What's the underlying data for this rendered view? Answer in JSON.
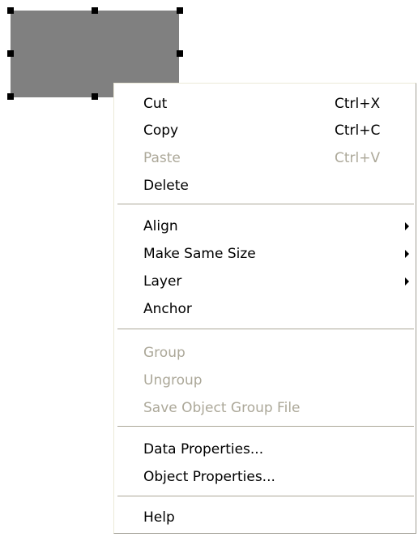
{
  "menu": {
    "cut": {
      "label": "Cut",
      "shortcut": "Ctrl+X"
    },
    "copy": {
      "label": "Copy",
      "shortcut": "Ctrl+C"
    },
    "paste": {
      "label": "Paste",
      "shortcut": "Ctrl+V"
    },
    "delete": {
      "label": "Delete"
    },
    "align": {
      "label": "Align"
    },
    "make_same_size": {
      "label": "Make Same Size"
    },
    "layer": {
      "label": "Layer"
    },
    "anchor": {
      "label": "Anchor"
    },
    "group": {
      "label": "Group"
    },
    "ungroup": {
      "label": "Ungroup"
    },
    "save_object_group_file": {
      "label": "Save Object Group File"
    },
    "data_properties": {
      "label": "Data Properties..."
    },
    "object_properties": {
      "label": "Object Properties..."
    },
    "help": {
      "label": "Help"
    }
  },
  "colors": {
    "shape_fill": "#808080",
    "disabled_text": "#aca899",
    "separator": "#aca899"
  },
  "icons": [
    "submenu-arrow-icon",
    "selection-handle"
  ]
}
